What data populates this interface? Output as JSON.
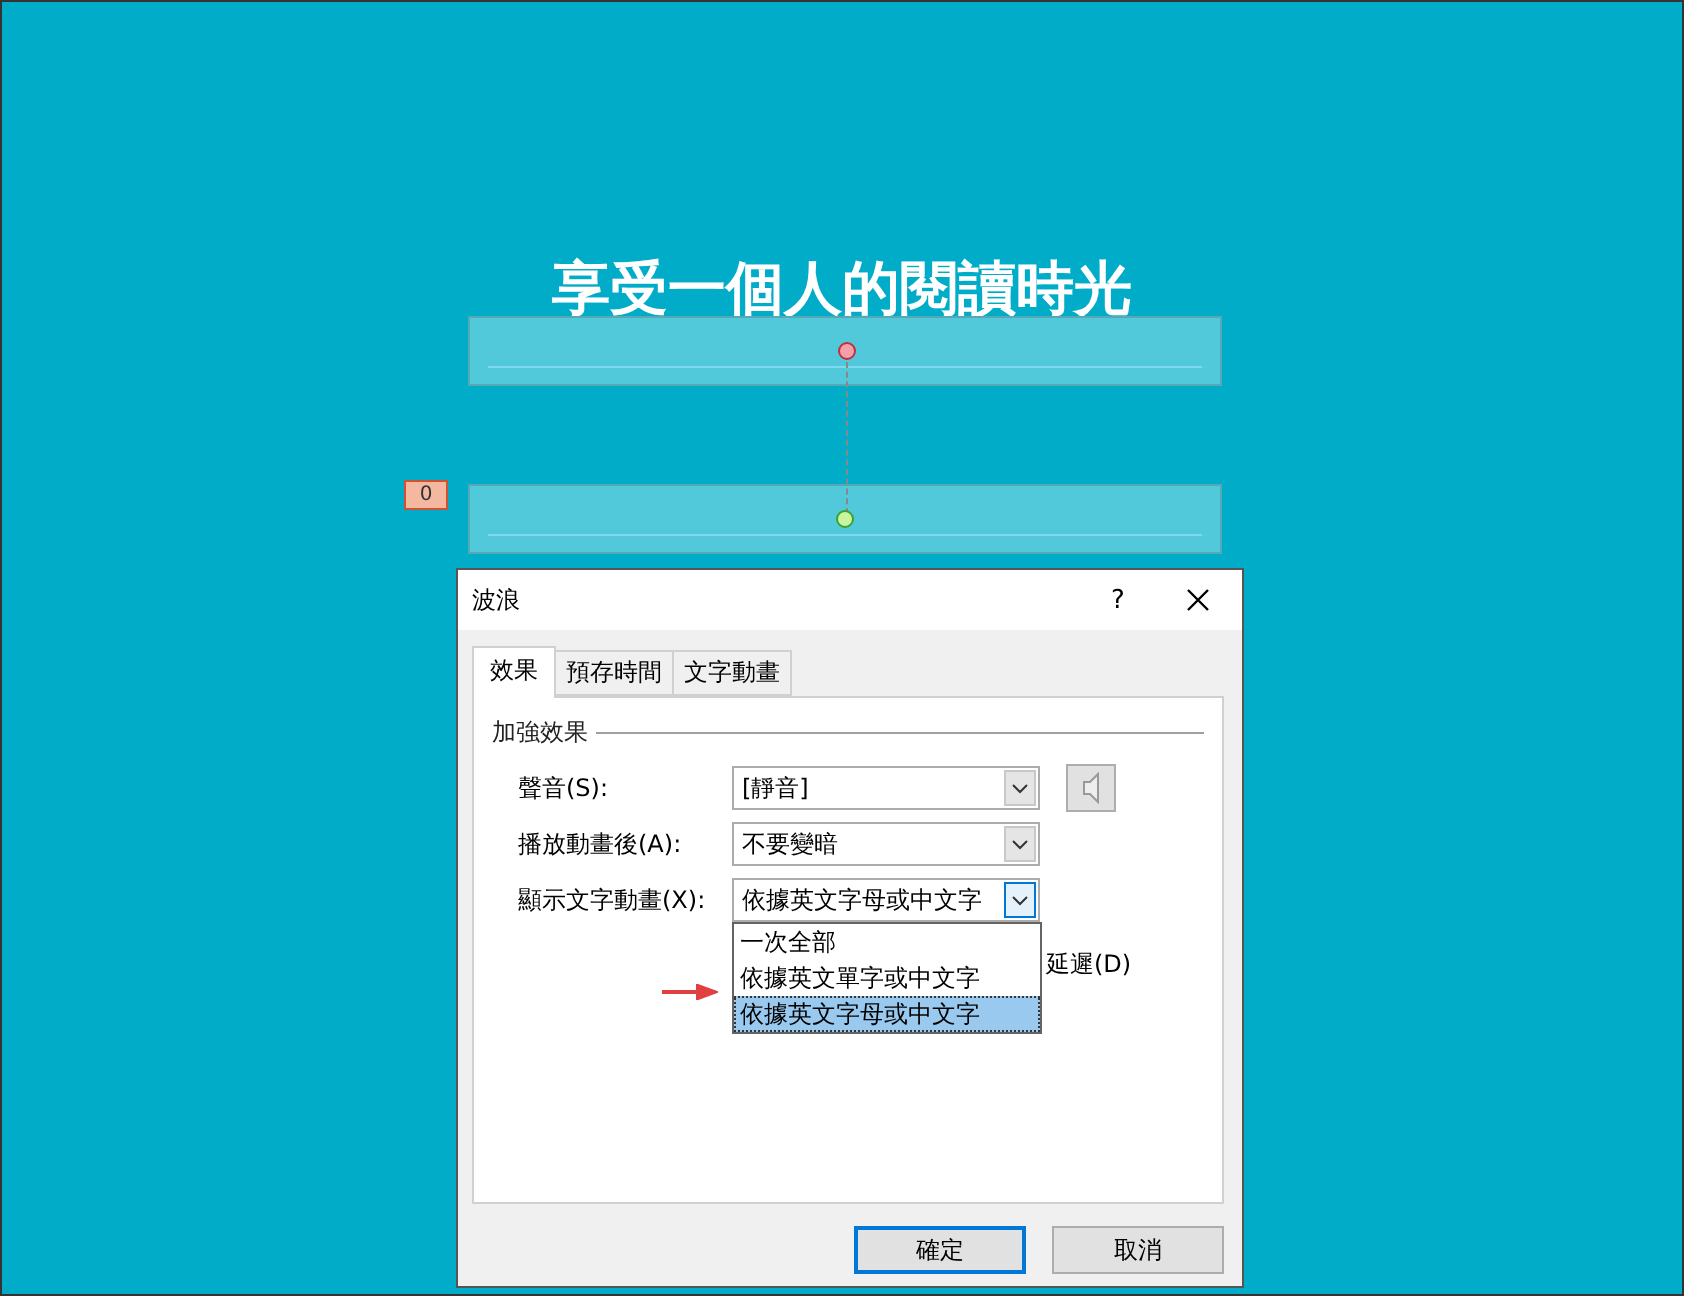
{
  "slide": {
    "title": "享受一個人的閱讀時光",
    "animation_badge": "0"
  },
  "dialog": {
    "title": "波浪",
    "help": "?",
    "tabs": [
      {
        "label": "效果",
        "selected": true
      },
      {
        "label": "預存時間",
        "selected": false
      },
      {
        "label": "文字動畫",
        "selected": false
      }
    ],
    "group": "加強效果",
    "fields": [
      {
        "label": "聲音(S):",
        "value": "[靜音]",
        "focused": false,
        "preview_button": true
      },
      {
        "label": "播放動畫後(A):",
        "value": "不要變暗",
        "focused": false,
        "preview_button": false
      },
      {
        "label": "顯示文字動畫(X):",
        "value": "依據英文字母或中文字",
        "focused": true,
        "preview_button": false
      }
    ],
    "dropdown": [
      {
        "label": "一次全部",
        "selected": false
      },
      {
        "label": "依據英文單字或中文字",
        "selected": false
      },
      {
        "label": "依據英文字母或中文字",
        "selected": true
      }
    ],
    "partial_label": "延遲(D)",
    "buttons": [
      {
        "label": "確定",
        "default": true
      },
      {
        "label": "取消",
        "default": false
      }
    ]
  }
}
